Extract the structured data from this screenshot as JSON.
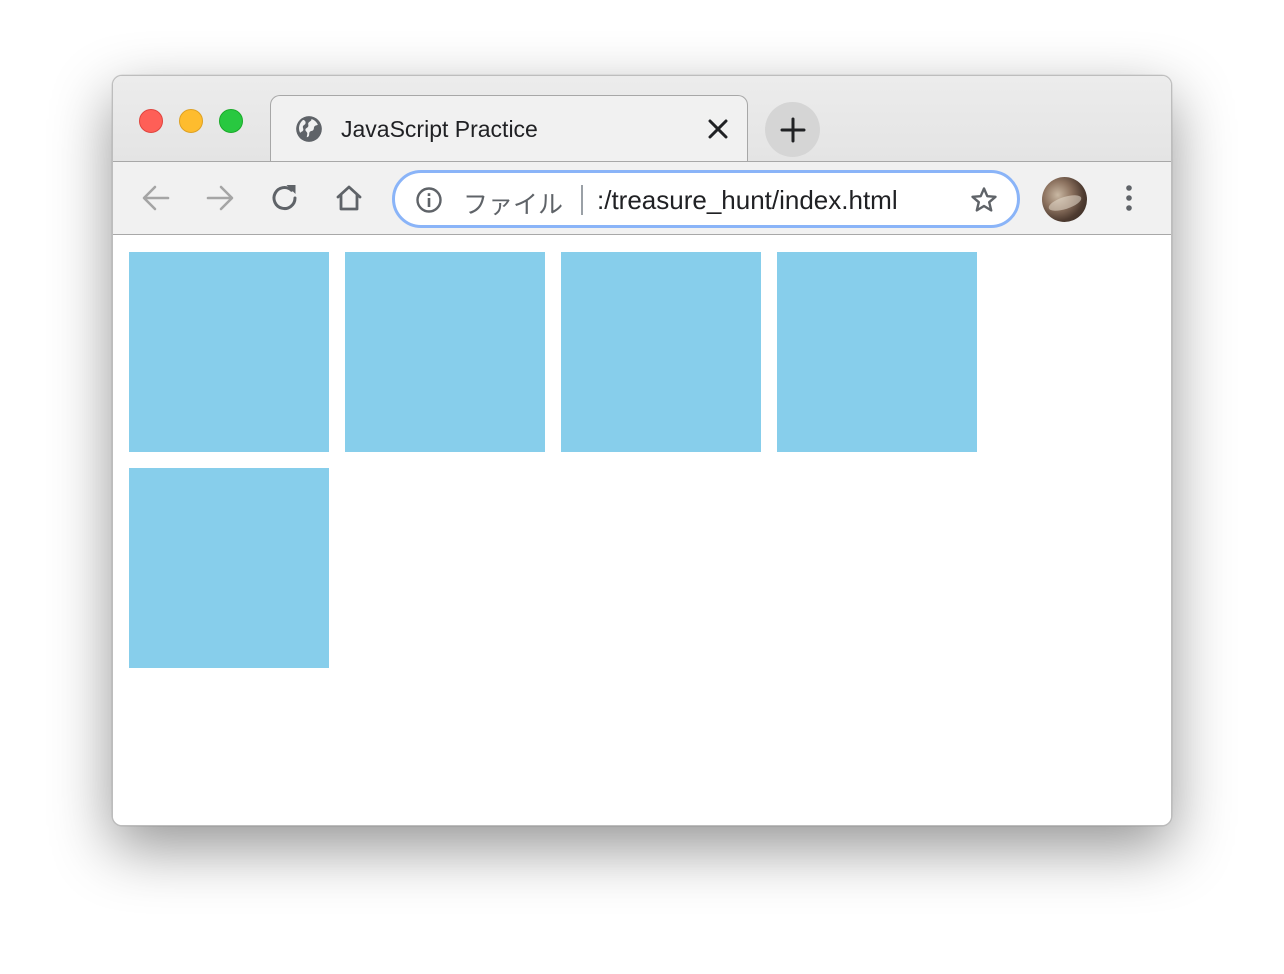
{
  "window": {
    "traffic_lights": [
      "close",
      "minimize",
      "zoom"
    ]
  },
  "tab": {
    "title": "JavaScript Practice",
    "favicon": "globe-icon",
    "close_icon": "close-icon"
  },
  "new_tab": {
    "icon": "plus-icon"
  },
  "toolbar": {
    "back_icon": "arrow-left-icon",
    "forward_icon": "arrow-right-icon",
    "reload_icon": "reload-icon",
    "home_icon": "home-icon",
    "menu_icon": "vertical-dots-icon"
  },
  "omnibox": {
    "info_icon": "info-icon",
    "scheme_label": "ファイル",
    "url": ":/treasure_hunt/index.html",
    "bookmark_icon": "star-icon"
  },
  "page": {
    "box_color": "#87ceeb",
    "boxes": [
      {
        "id": 1
      },
      {
        "id": 2
      },
      {
        "id": 3
      },
      {
        "id": 4
      },
      {
        "id": 5
      }
    ]
  }
}
